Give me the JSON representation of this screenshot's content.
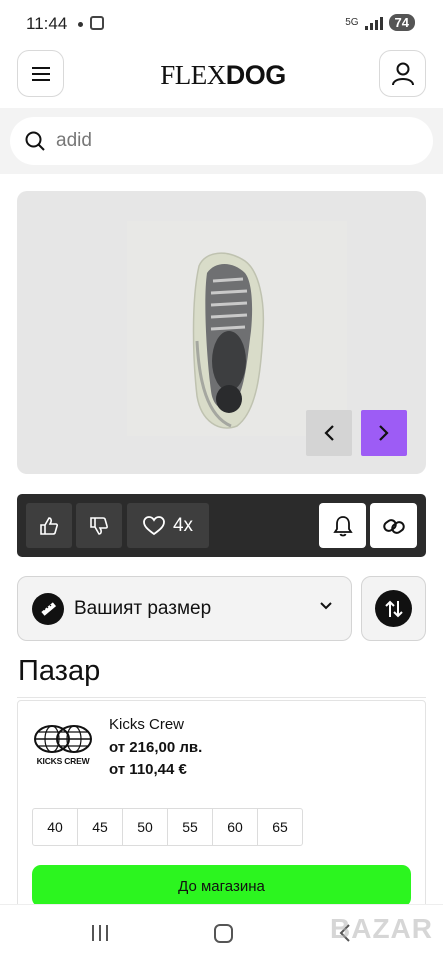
{
  "status_bar": {
    "time": "11:44",
    "network": "5G",
    "battery": "74"
  },
  "header": {
    "logo_part1": "FLEX",
    "logo_part2": "DOG"
  },
  "search": {
    "value": "adid"
  },
  "product": {
    "favorites_count": "4x"
  },
  "size_selector": {
    "label": "Вашият размер"
  },
  "market": {
    "title": "Пазар"
  },
  "offer": {
    "store_logo_text": "KICKS CREW",
    "store_name": "Kicks Crew",
    "price_bgn": "от 216,00 лв.",
    "price_eur": "от 110,44 €",
    "sizes": [
      "40",
      "45",
      "50",
      "55",
      "60",
      "65"
    ],
    "button_label": "До магазина"
  },
  "watermark": "BAZAR",
  "colors": {
    "accent_purple": "#9d5cf5",
    "shop_green": "#2cf51f",
    "action_bar": "#2b2b2b"
  }
}
